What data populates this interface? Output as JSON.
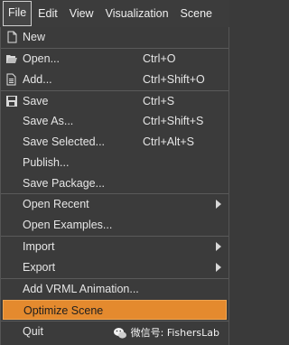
{
  "menubar": {
    "items": [
      "File",
      "Edit",
      "View",
      "Visualization",
      "Scene"
    ]
  },
  "menu": {
    "items": [
      {
        "label": "New",
        "shortcut": "",
        "icon": "new-file-icon"
      },
      {
        "label": "Open...",
        "shortcut": "Ctrl+O",
        "icon": "open-folder-icon"
      },
      {
        "label": "Add...",
        "shortcut": "Ctrl+Shift+O",
        "icon": "add-document-icon"
      },
      {
        "label": "Save",
        "shortcut": "Ctrl+S",
        "icon": "save-disk-icon"
      },
      {
        "label": "Save As...",
        "shortcut": "Ctrl+Shift+S"
      },
      {
        "label": "Save Selected...",
        "shortcut": "Ctrl+Alt+S"
      },
      {
        "label": "Publish...",
        "shortcut": ""
      },
      {
        "label": "Save Package...",
        "shortcut": ""
      },
      {
        "label": "Open Recent",
        "submenu": true
      },
      {
        "label": "Open Examples...",
        "shortcut": ""
      },
      {
        "label": "Import",
        "submenu": true
      },
      {
        "label": "Export",
        "submenu": true
      },
      {
        "label": "Add VRML Animation...",
        "shortcut": ""
      },
      {
        "label": "Optimize Scene",
        "shortcut": "",
        "highlighted": true
      },
      {
        "label": "Quit",
        "shortcut": ""
      }
    ]
  },
  "watermark": {
    "text": "微信号: FishersLab",
    "icon": "wechat-icon"
  },
  "colors": {
    "highlight": "#e48a2e",
    "background": "#3b3b3b"
  }
}
